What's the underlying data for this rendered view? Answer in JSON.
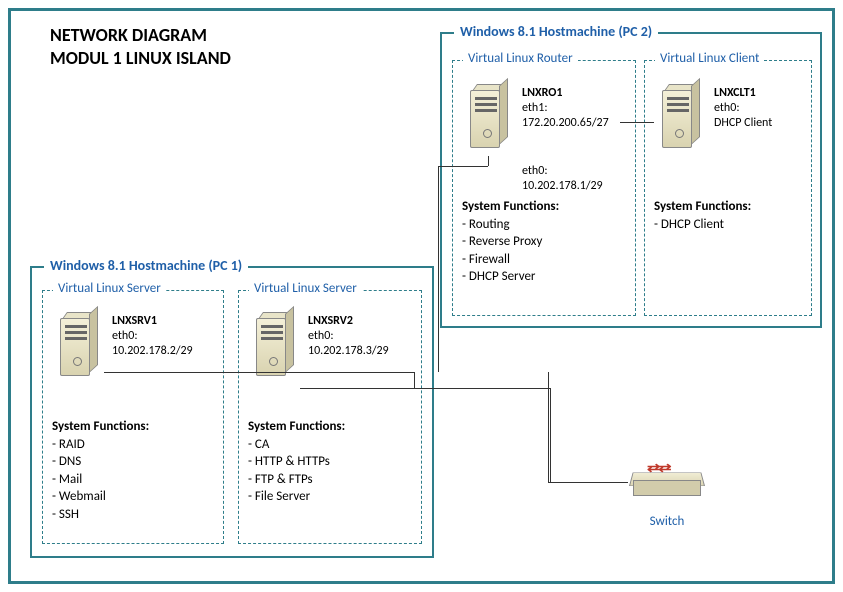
{
  "title_line1": "NETWORK DIAGRAM",
  "title_line2": "MODUL 1 LINUX ISLAND",
  "pc1": {
    "legend": "Windows 8.1 Hostmachine (PC 1)"
  },
  "pc2": {
    "legend": "Windows 8.1 Hostmachine (PC 2)"
  },
  "vm1": {
    "legend": "Virtual Linux Server",
    "hostname": "LNXSRV1",
    "iface": "eth0:",
    "ip": "10.202.178.2/29",
    "sysfunc_head": "System Functions:",
    "f1": "- RAID",
    "f2": "- DNS",
    "f3": "- Mail",
    "f4": "- Webmail",
    "f5": "- SSH"
  },
  "vm2": {
    "legend": "Virtual Linux Server",
    "hostname": "LNXSRV2",
    "iface": "eth0:",
    "ip": "10.202.178.3/29",
    "sysfunc_head": "System Functions:",
    "f1": "- CA",
    "f2": "- HTTP & HTTPs",
    "f3": "- FTP & FTPs",
    "f4": "- File Server"
  },
  "vm3": {
    "legend": "Virtual Linux Router",
    "hostname": "LNXRO1",
    "iface1": "eth1:",
    "ip1": "172.20.200.65/27",
    "iface0": "eth0:",
    "ip0": "10.202.178.1/29",
    "sysfunc_head": "System Functions:",
    "f1": "- Routing",
    "f2": "- Reverse Proxy",
    "f3": "- Firewall",
    "f4": "- DHCP Server"
  },
  "vm4": {
    "legend": "Virtual Linux Client",
    "hostname": "LNXCLT1",
    "iface": "eth0:",
    "ip": "DHCP Client",
    "sysfunc_head": "System Functions:",
    "f1": "- DHCP Client"
  },
  "switch": {
    "label": "Switch"
  }
}
